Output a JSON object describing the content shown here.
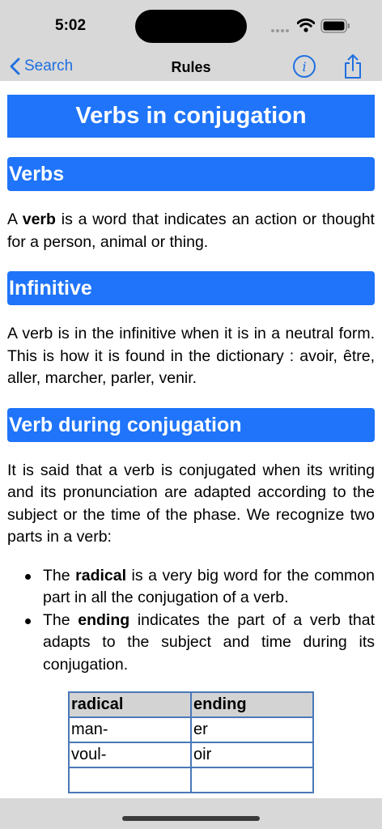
{
  "status_bar": {
    "time": "5:02"
  },
  "nav": {
    "back_label": "Search",
    "title": "Rules"
  },
  "article": {
    "title": "Verbs in conjugation",
    "verbs": {
      "heading": "Verbs",
      "text_before": "A ",
      "term": "verb",
      "text_after": " is a word that indicates an action or thought for a person, animal or thing."
    },
    "infinitive": {
      "heading": "Infinitive",
      "text": "A verb is in the infinitive when it is in a neutral form. This is how it is found in the dictionary : avoir, être, aller, marcher, parler, venir."
    },
    "conjugation": {
      "heading": "Verb during conjugation",
      "text": "It is said that a verb is conjugated when its writing and its pronunciation are adapted according to the subject or the time of the phase. We recognize two parts in a verb:",
      "bullets": [
        {
          "before": "The ",
          "term": "radical",
          "after": " is a very big word for the common part in all the conjugation of a verb."
        },
        {
          "before": "The ",
          "term": "ending",
          "after": " indicates the part of a verb that adapts to the subject and time during its conjugation."
        }
      ]
    },
    "table": {
      "headers": [
        "radical",
        "ending"
      ],
      "rows": [
        [
          "man-",
          "er"
        ],
        [
          "voul-",
          "oir"
        ],
        [
          "",
          ""
        ]
      ]
    }
  }
}
